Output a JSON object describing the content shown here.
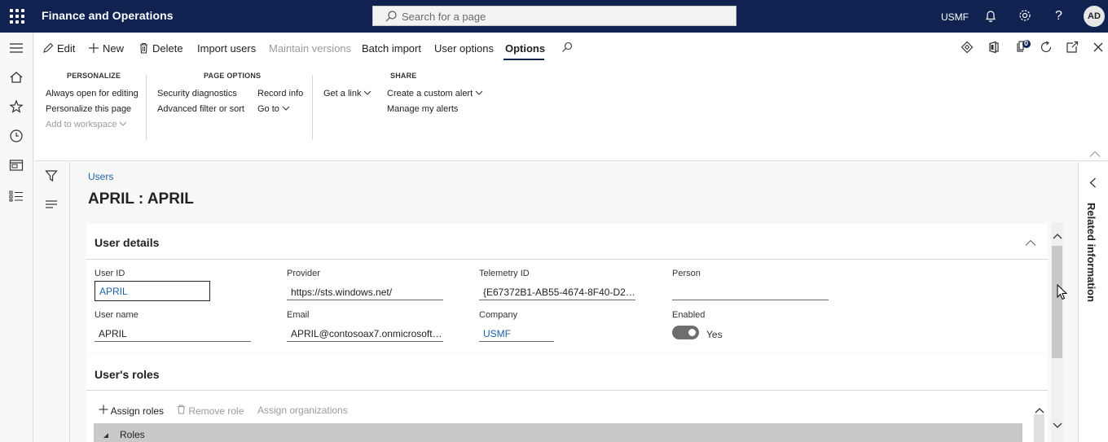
{
  "topbar": {
    "app_title": "Finance and Operations",
    "search_placeholder": "Search for a page",
    "company": "USMF",
    "avatar_initials": "AD"
  },
  "actions": {
    "edit": "Edit",
    "new": "New",
    "delete": "Delete",
    "import_users": "Import users",
    "maintain_versions": "Maintain versions",
    "batch_import": "Batch import",
    "user_options": "User options",
    "options": "Options",
    "badge_count": "0"
  },
  "ribbon": {
    "personalize": {
      "title": "PERSONALIZE",
      "items": [
        "Always open for editing",
        "Personalize this page",
        "Add to workspace"
      ]
    },
    "page_options": {
      "title": "PAGE OPTIONS",
      "items": [
        "Security diagnostics",
        "Advanced filter or sort",
        "Record info",
        "Go to"
      ]
    },
    "share": {
      "title": "SHARE",
      "items": [
        "Get a link",
        "Create a custom alert",
        "Manage my alerts"
      ]
    }
  },
  "page": {
    "breadcrumb": "Users",
    "title": "APRIL : APRIL"
  },
  "user_details": {
    "header": "User details",
    "fields": {
      "user_id": {
        "label": "User ID",
        "value": "APRIL"
      },
      "provider": {
        "label": "Provider",
        "value": "https://sts.windows.net/"
      },
      "telemetry_id": {
        "label": "Telemetry ID",
        "value": "{E67372B1-AB55-4674-8F40-D2…"
      },
      "person": {
        "label": "Person",
        "value": ""
      },
      "user_name": {
        "label": "User name",
        "value": "APRIL"
      },
      "email": {
        "label": "Email",
        "value": "APRIL@contosoax7.onmicrosoft…"
      },
      "company": {
        "label": "Company",
        "value": "USMF"
      },
      "enabled": {
        "label": "Enabled",
        "value": "Yes"
      }
    }
  },
  "roles": {
    "header": "User's roles",
    "assign_roles": "Assign roles",
    "remove_role": "Remove role",
    "assign_organizations": "Assign organizations",
    "grid_column": "Roles"
  },
  "related_panel": {
    "label": "Related information"
  }
}
